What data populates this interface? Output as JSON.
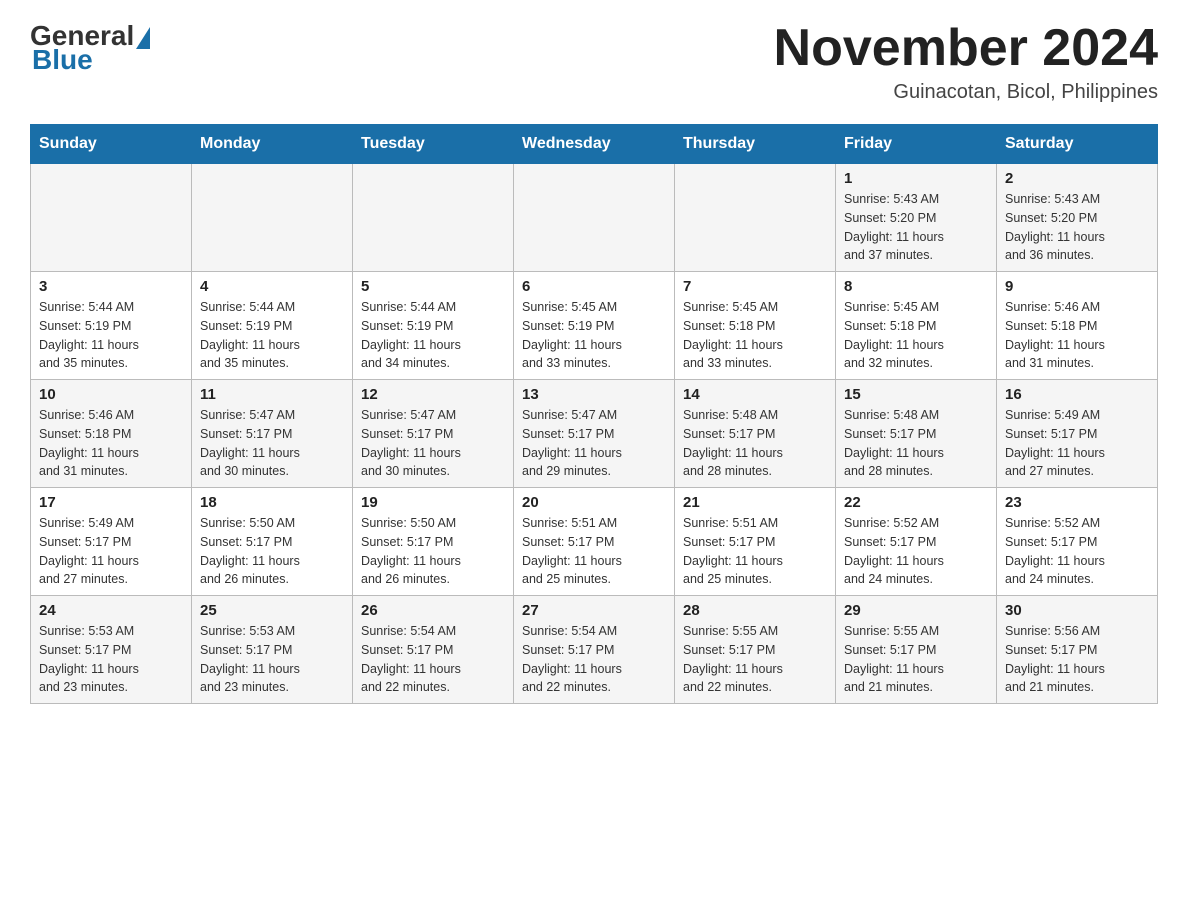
{
  "header": {
    "logo": {
      "general": "General",
      "blue": "Blue"
    },
    "title": "November 2024",
    "location": "Guinacotan, Bicol, Philippines"
  },
  "calendar": {
    "days_of_week": [
      "Sunday",
      "Monday",
      "Tuesday",
      "Wednesday",
      "Thursday",
      "Friday",
      "Saturday"
    ],
    "weeks": [
      {
        "row_class": "row-first",
        "days": [
          {
            "num": "",
            "info": ""
          },
          {
            "num": "",
            "info": ""
          },
          {
            "num": "",
            "info": ""
          },
          {
            "num": "",
            "info": ""
          },
          {
            "num": "",
            "info": ""
          },
          {
            "num": "1",
            "info": "Sunrise: 5:43 AM\nSunset: 5:20 PM\nDaylight: 11 hours\nand 37 minutes."
          },
          {
            "num": "2",
            "info": "Sunrise: 5:43 AM\nSunset: 5:20 PM\nDaylight: 11 hours\nand 36 minutes."
          }
        ]
      },
      {
        "row_class": "row-second",
        "days": [
          {
            "num": "3",
            "info": "Sunrise: 5:44 AM\nSunset: 5:19 PM\nDaylight: 11 hours\nand 35 minutes."
          },
          {
            "num": "4",
            "info": "Sunrise: 5:44 AM\nSunset: 5:19 PM\nDaylight: 11 hours\nand 35 minutes."
          },
          {
            "num": "5",
            "info": "Sunrise: 5:44 AM\nSunset: 5:19 PM\nDaylight: 11 hours\nand 34 minutes."
          },
          {
            "num": "6",
            "info": "Sunrise: 5:45 AM\nSunset: 5:19 PM\nDaylight: 11 hours\nand 33 minutes."
          },
          {
            "num": "7",
            "info": "Sunrise: 5:45 AM\nSunset: 5:18 PM\nDaylight: 11 hours\nand 33 minutes."
          },
          {
            "num": "8",
            "info": "Sunrise: 5:45 AM\nSunset: 5:18 PM\nDaylight: 11 hours\nand 32 minutes."
          },
          {
            "num": "9",
            "info": "Sunrise: 5:46 AM\nSunset: 5:18 PM\nDaylight: 11 hours\nand 31 minutes."
          }
        ]
      },
      {
        "row_class": "row-third",
        "days": [
          {
            "num": "10",
            "info": "Sunrise: 5:46 AM\nSunset: 5:18 PM\nDaylight: 11 hours\nand 31 minutes."
          },
          {
            "num": "11",
            "info": "Sunrise: 5:47 AM\nSunset: 5:17 PM\nDaylight: 11 hours\nand 30 minutes."
          },
          {
            "num": "12",
            "info": "Sunrise: 5:47 AM\nSunset: 5:17 PM\nDaylight: 11 hours\nand 30 minutes."
          },
          {
            "num": "13",
            "info": "Sunrise: 5:47 AM\nSunset: 5:17 PM\nDaylight: 11 hours\nand 29 minutes."
          },
          {
            "num": "14",
            "info": "Sunrise: 5:48 AM\nSunset: 5:17 PM\nDaylight: 11 hours\nand 28 minutes."
          },
          {
            "num": "15",
            "info": "Sunrise: 5:48 AM\nSunset: 5:17 PM\nDaylight: 11 hours\nand 28 minutes."
          },
          {
            "num": "16",
            "info": "Sunrise: 5:49 AM\nSunset: 5:17 PM\nDaylight: 11 hours\nand 27 minutes."
          }
        ]
      },
      {
        "row_class": "row-fourth",
        "days": [
          {
            "num": "17",
            "info": "Sunrise: 5:49 AM\nSunset: 5:17 PM\nDaylight: 11 hours\nand 27 minutes."
          },
          {
            "num": "18",
            "info": "Sunrise: 5:50 AM\nSunset: 5:17 PM\nDaylight: 11 hours\nand 26 minutes."
          },
          {
            "num": "19",
            "info": "Sunrise: 5:50 AM\nSunset: 5:17 PM\nDaylight: 11 hours\nand 26 minutes."
          },
          {
            "num": "20",
            "info": "Sunrise: 5:51 AM\nSunset: 5:17 PM\nDaylight: 11 hours\nand 25 minutes."
          },
          {
            "num": "21",
            "info": "Sunrise: 5:51 AM\nSunset: 5:17 PM\nDaylight: 11 hours\nand 25 minutes."
          },
          {
            "num": "22",
            "info": "Sunrise: 5:52 AM\nSunset: 5:17 PM\nDaylight: 11 hours\nand 24 minutes."
          },
          {
            "num": "23",
            "info": "Sunrise: 5:52 AM\nSunset: 5:17 PM\nDaylight: 11 hours\nand 24 minutes."
          }
        ]
      },
      {
        "row_class": "row-fifth",
        "days": [
          {
            "num": "24",
            "info": "Sunrise: 5:53 AM\nSunset: 5:17 PM\nDaylight: 11 hours\nand 23 minutes."
          },
          {
            "num": "25",
            "info": "Sunrise: 5:53 AM\nSunset: 5:17 PM\nDaylight: 11 hours\nand 23 minutes."
          },
          {
            "num": "26",
            "info": "Sunrise: 5:54 AM\nSunset: 5:17 PM\nDaylight: 11 hours\nand 22 minutes."
          },
          {
            "num": "27",
            "info": "Sunrise: 5:54 AM\nSunset: 5:17 PM\nDaylight: 11 hours\nand 22 minutes."
          },
          {
            "num": "28",
            "info": "Sunrise: 5:55 AM\nSunset: 5:17 PM\nDaylight: 11 hours\nand 22 minutes."
          },
          {
            "num": "29",
            "info": "Sunrise: 5:55 AM\nSunset: 5:17 PM\nDaylight: 11 hours\nand 21 minutes."
          },
          {
            "num": "30",
            "info": "Sunrise: 5:56 AM\nSunset: 5:17 PM\nDaylight: 11 hours\nand 21 minutes."
          }
        ]
      }
    ]
  }
}
